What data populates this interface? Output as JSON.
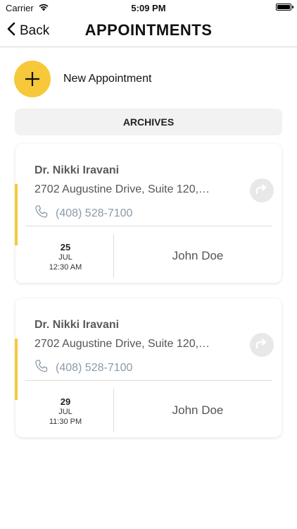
{
  "status": {
    "carrier": "Carrier",
    "time": "5:09 PM"
  },
  "nav": {
    "back_label": "Back",
    "title": "APPOINTMENTS"
  },
  "new_appointment": {
    "label": "New Appointment"
  },
  "archives": {
    "label": "ARCHIVES"
  },
  "appointments": [
    {
      "doctor": "Dr. Nikki Iravani",
      "address": "2702 Augustine Drive, Suite 120,…",
      "phone": "(408) 528-7100",
      "day": "25",
      "month": "JUL",
      "time": "12:30 AM",
      "patient": "John Doe"
    },
    {
      "doctor": "Dr. Nikki Iravani",
      "address": "2702 Augustine Drive, Suite 120,…",
      "phone": "(408) 528-7100",
      "day": "29",
      "month": "JUL",
      "time": "11:30 PM",
      "patient": "John Doe"
    }
  ],
  "colors": {
    "accent": "#f6c83a",
    "phone": "#8a9aaa"
  }
}
